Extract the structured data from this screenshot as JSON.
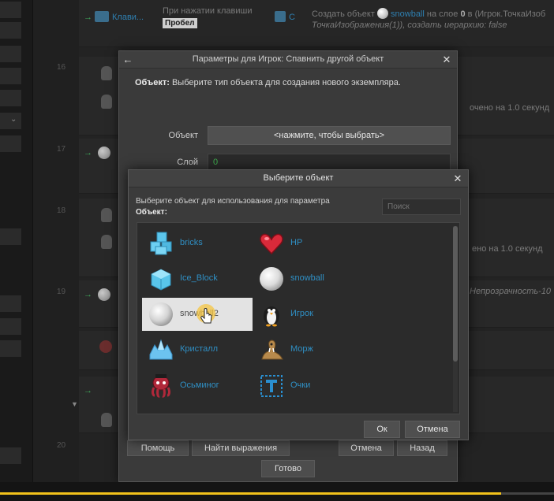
{
  "background": {
    "event_row": {
      "trigger_label": "Клави...",
      "condition_line": "При нажатии клавиши",
      "key_badge": "Пробел",
      "action_prefix": "С",
      "action_line1_a": "Создать объект",
      "action_line1_obj": "snowball",
      "action_line1_b": "на слое",
      "action_line1_layer": "0",
      "action_line1_c": "в (Игрок.ТочкаИзоб",
      "action_line2": "ТочкаИзображения(1)), создать иерархию: false"
    },
    "right_texts": {
      "wait_1": "очено на 1.0 секунд",
      "wait_2": "ено на 1.0 секунд",
      "opacity": "Непрозрачность-10"
    },
    "row_numbers": [
      "16",
      "17",
      "18",
      "19",
      "20"
    ]
  },
  "dialog_params": {
    "title": "Параметры для Игрок: Спавнить другой объект",
    "desc_bold": "Объект:",
    "desc_text": "Выберите тип объекта для создания нового экземпляра.",
    "object_label": "Объект",
    "object_button": "<нажмите, чтобы выбрать>",
    "layer_label": "Слой",
    "layer_value": "0",
    "help_button": "Помощь",
    "find_expr_button": "Найти выражения",
    "cancel_button": "Отмена",
    "back_button": "Назад",
    "done_button": "Готово"
  },
  "dialog_pick": {
    "title": "Выберите объект",
    "instruction": "Выберите объект для использования для параметра",
    "instruction_bold": "Объект:",
    "search_placeholder": "Поиск",
    "items": [
      {
        "label": "bricks",
        "icon": "ice-cubes-icon"
      },
      {
        "label": "HP",
        "icon": "heart-icon"
      },
      {
        "label": "Ice_Block",
        "icon": "ice-block-icon"
      },
      {
        "label": "snowball",
        "icon": "snowball-icon"
      },
      {
        "label": "snowball2",
        "icon": "snowball-icon"
      },
      {
        "label": "Игрок",
        "icon": "penguin-icon"
      },
      {
        "label": "Кристалл",
        "icon": "crystal-icon"
      },
      {
        "label": "Морж",
        "icon": "walrus-icon"
      },
      {
        "label": "Осьминог",
        "icon": "octopus-icon"
      },
      {
        "label": "Очки",
        "icon": "text-t-icon"
      }
    ],
    "selected": "snowball2",
    "ok_button": "Ок",
    "cancel_button": "Отмена"
  },
  "colors": {
    "link": "#2f8fc4",
    "selection": "#e3e3e3",
    "progress": "#f2c21b",
    "layer_value": "#3fae4f"
  },
  "video_progress": 0.905
}
